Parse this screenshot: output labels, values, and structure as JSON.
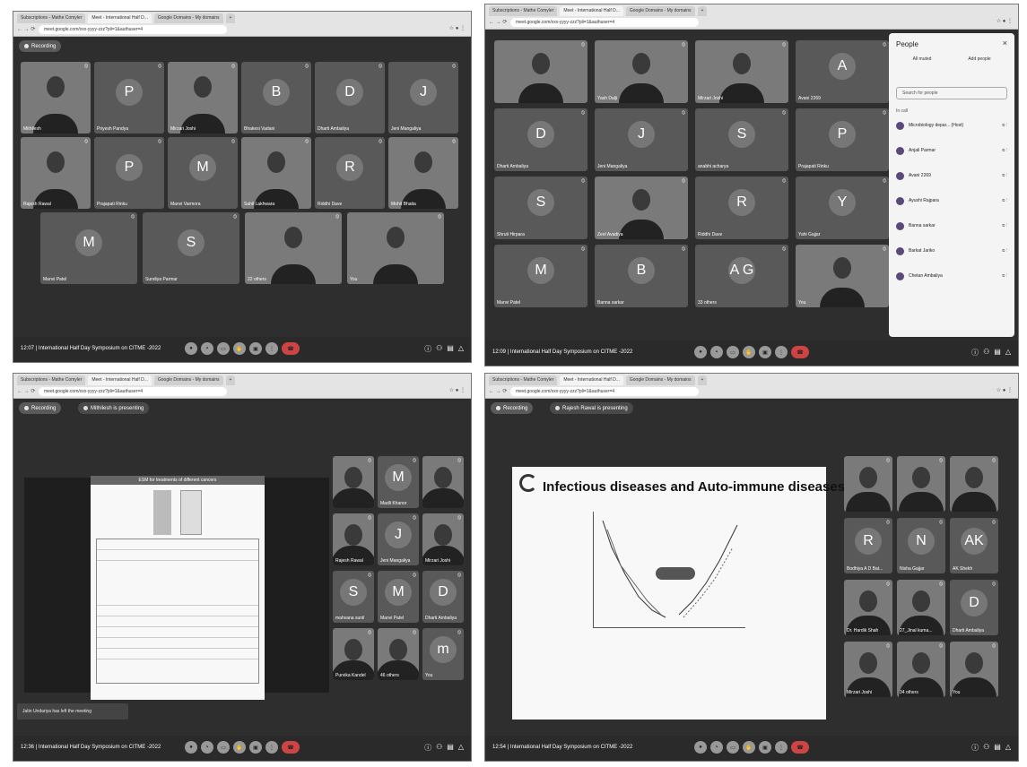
{
  "q1": {
    "tabs": [
      "Subscriptions - Mathe Comyler",
      "Meet - International Half D...",
      "Google Domains - My domains",
      "+"
    ],
    "address": "meet.google.com/xxx-yyyy-zzz?pli=1&authuser=4",
    "recording": "Recording",
    "meeting_line": "12:07  |  International Half Day Symposium on CITME -2022",
    "tiles": [
      {
        "name": "Mithilesh",
        "initial": ""
      },
      {
        "name": "Priyesh Pandya",
        "initial": "P"
      },
      {
        "name": "Mirzari Joshi",
        "initial": ""
      },
      {
        "name": "Bhakesi Vadani",
        "initial": "B"
      },
      {
        "name": "Dharti Ambaliya",
        "initial": "D"
      },
      {
        "name": "Jeni Mangaliya",
        "initial": "J"
      },
      {
        "name": "Rajesh Rawal",
        "initial": ""
      },
      {
        "name": "Prajapati Rinku",
        "initial": "P"
      },
      {
        "name": "Manvi Varmora",
        "initial": "M"
      },
      {
        "name": "Sahil Lakhwara",
        "initial": ""
      },
      {
        "name": "Riddhi Dave",
        "initial": "R"
      },
      {
        "name": "Mohit Bhatia",
        "initial": ""
      },
      {
        "name": "Manvi Patel",
        "initial": "M"
      },
      {
        "name": "Sundiya Parmar",
        "initial": "S"
      },
      {
        "name": "22 others",
        "initial": ""
      },
      {
        "name": "You",
        "initial": ""
      }
    ]
  },
  "q2": {
    "tabs": [
      "Subscriptions - Mathe Comyler",
      "Meet - International Half D...",
      "Google Domains - My domains",
      "+"
    ],
    "address": "meet.google.com/xxx-yyyy-zzz?pli=1&authuser=4",
    "meeting_line": "12:09  |  International Half Day Symposium on CITME -2022",
    "tiles": [
      {
        "name": "",
        "initial": ""
      },
      {
        "name": "Yash Dalji",
        "initial": ""
      },
      {
        "name": "Mirzari Joshi",
        "initial": ""
      },
      {
        "name": "Avani 2269",
        "initial": "A"
      },
      {
        "name": "Dharti Ambaliya",
        "initial": "D"
      },
      {
        "name": "Jeni Mangaliya",
        "initial": "J"
      },
      {
        "name": "anabhi acharya",
        "initial": "S"
      },
      {
        "name": "Prajapati Rinku",
        "initial": "P"
      },
      {
        "name": "Shruti Hirpara",
        "initial": "S"
      },
      {
        "name": "Zeel Avadiya",
        "initial": ""
      },
      {
        "name": "Riddhi Dave",
        "initial": "R"
      },
      {
        "name": "Yahi Gajjar",
        "initial": "Y"
      },
      {
        "name": "Manvi Patel",
        "initial": "M"
      },
      {
        "name": "Banna sarkar",
        "initial": "B"
      },
      {
        "name": "33 others",
        "initial": "A G"
      },
      {
        "name": "You",
        "initial": ""
      }
    ],
    "people_panel": {
      "title": "People",
      "close": "×",
      "add_people": "Add people",
      "all_muted": "All muted",
      "search_placeholder": "Search for people",
      "in_call": "In call",
      "people": [
        "Microbiology depar... (Host)",
        "Anjali Parmar",
        "Avani 2269",
        "Ayushi Rajpara",
        "Banna sarkar",
        "Barkat Jariko",
        "Chetan Ambaliya"
      ]
    }
  },
  "q3": {
    "tabs": [
      "Subscriptions - Mathe Comyler",
      "Meet - International Half D...",
      "Google Domains - My domains",
      "+"
    ],
    "address": "meet.google.com/xxx-yyyy-zzz?pli=1&authuser=4",
    "recording": "Recording",
    "presenting": "Mithilesh is presenting",
    "doc_title": "ESM for treatments of different cancers",
    "toast": "Jatin Undariya has left the meeting",
    "meeting_line": "12:36  |  International Half Day Symposium on CITME -2022",
    "tiles": [
      {
        "name": "",
        "initial": ""
      },
      {
        "name": "Madli Khanor",
        "initial": "M"
      },
      {
        "name": "",
        "initial": ""
      },
      {
        "name": "Rajesh Rawal",
        "initial": ""
      },
      {
        "name": "Jeni Mangaliya",
        "initial": "J"
      },
      {
        "name": "Mirzari Joshi",
        "initial": ""
      },
      {
        "name": "mahvana sunil",
        "initial": "S"
      },
      {
        "name": "Manvi Patel",
        "initial": "M"
      },
      {
        "name": "Dharti Ambaliya",
        "initial": "D"
      },
      {
        "name": "Purvika Kandel",
        "initial": ""
      },
      {
        "name": "46 others",
        "initial": ""
      },
      {
        "name": "You",
        "initial": "m"
      }
    ]
  },
  "q4": {
    "tabs": [
      "Subscriptions - Mathe Comyler",
      "Meet - International Half D...",
      "Google Domains - My domains",
      "+"
    ],
    "address": "meet.google.com/xxx-yyyy-zzz?pli=1&authuser=4",
    "recording": "Recording",
    "presenting": "Rajesh Rawal is presenting",
    "slide_title": "Infectious diseases and Auto-immune diseases",
    "meeting_line": "12:54  |  International Half Day Symposium on CITME -2022",
    "tiles": [
      {
        "name": "",
        "initial": ""
      },
      {
        "name": "",
        "initial": ""
      },
      {
        "name": "",
        "initial": ""
      },
      {
        "name": "Bodhiya A D Bat...",
        "initial": "R"
      },
      {
        "name": "Nisha Gajjar",
        "initial": "N"
      },
      {
        "name": "AK Shekh",
        "initial": "AK"
      },
      {
        "name": "Dr. Hardik Shah",
        "initial": ""
      },
      {
        "name": "27_Jinal kuma...",
        "initial": ""
      },
      {
        "name": "Dharti Ambaliya",
        "initial": "D"
      },
      {
        "name": "Mirzari Joshi",
        "initial": ""
      },
      {
        "name": "34 others",
        "initial": ""
      },
      {
        "name": "You",
        "initial": ""
      }
    ]
  },
  "colors": {
    "tile": "#595959",
    "stage": "#2e2e2e",
    "end_call": "#c44444"
  }
}
